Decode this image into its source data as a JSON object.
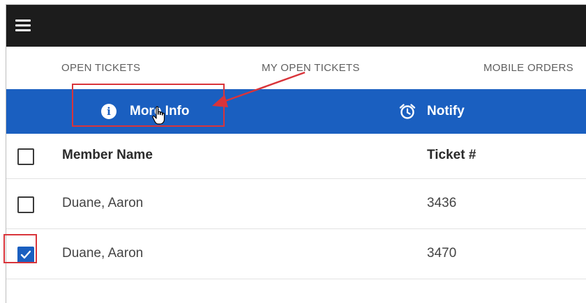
{
  "appbar": {
    "menu_icon": "hamburger-menu-icon"
  },
  "tabs": [
    {
      "label": "OPEN TICKETS"
    },
    {
      "label": "MY OPEN TICKETS"
    },
    {
      "label": "MOBILE ORDERS"
    }
  ],
  "actions": {
    "more_info": {
      "label": "More Info",
      "icon": "info-icon"
    },
    "notify": {
      "label": "Notify",
      "icon": "alarm-clock-icon"
    }
  },
  "table": {
    "columns": [
      "Member Name",
      "Ticket #"
    ],
    "rows": [
      {
        "name": "Duane, Aaron",
        "ticket": "3436",
        "checked": false
      },
      {
        "name": "Duane, Aaron",
        "ticket": "3470",
        "checked": true
      }
    ]
  },
  "colors": {
    "appbar": "#1c1c1c",
    "action_bar": "#1a5fc0",
    "highlight": "#d9343a"
  }
}
